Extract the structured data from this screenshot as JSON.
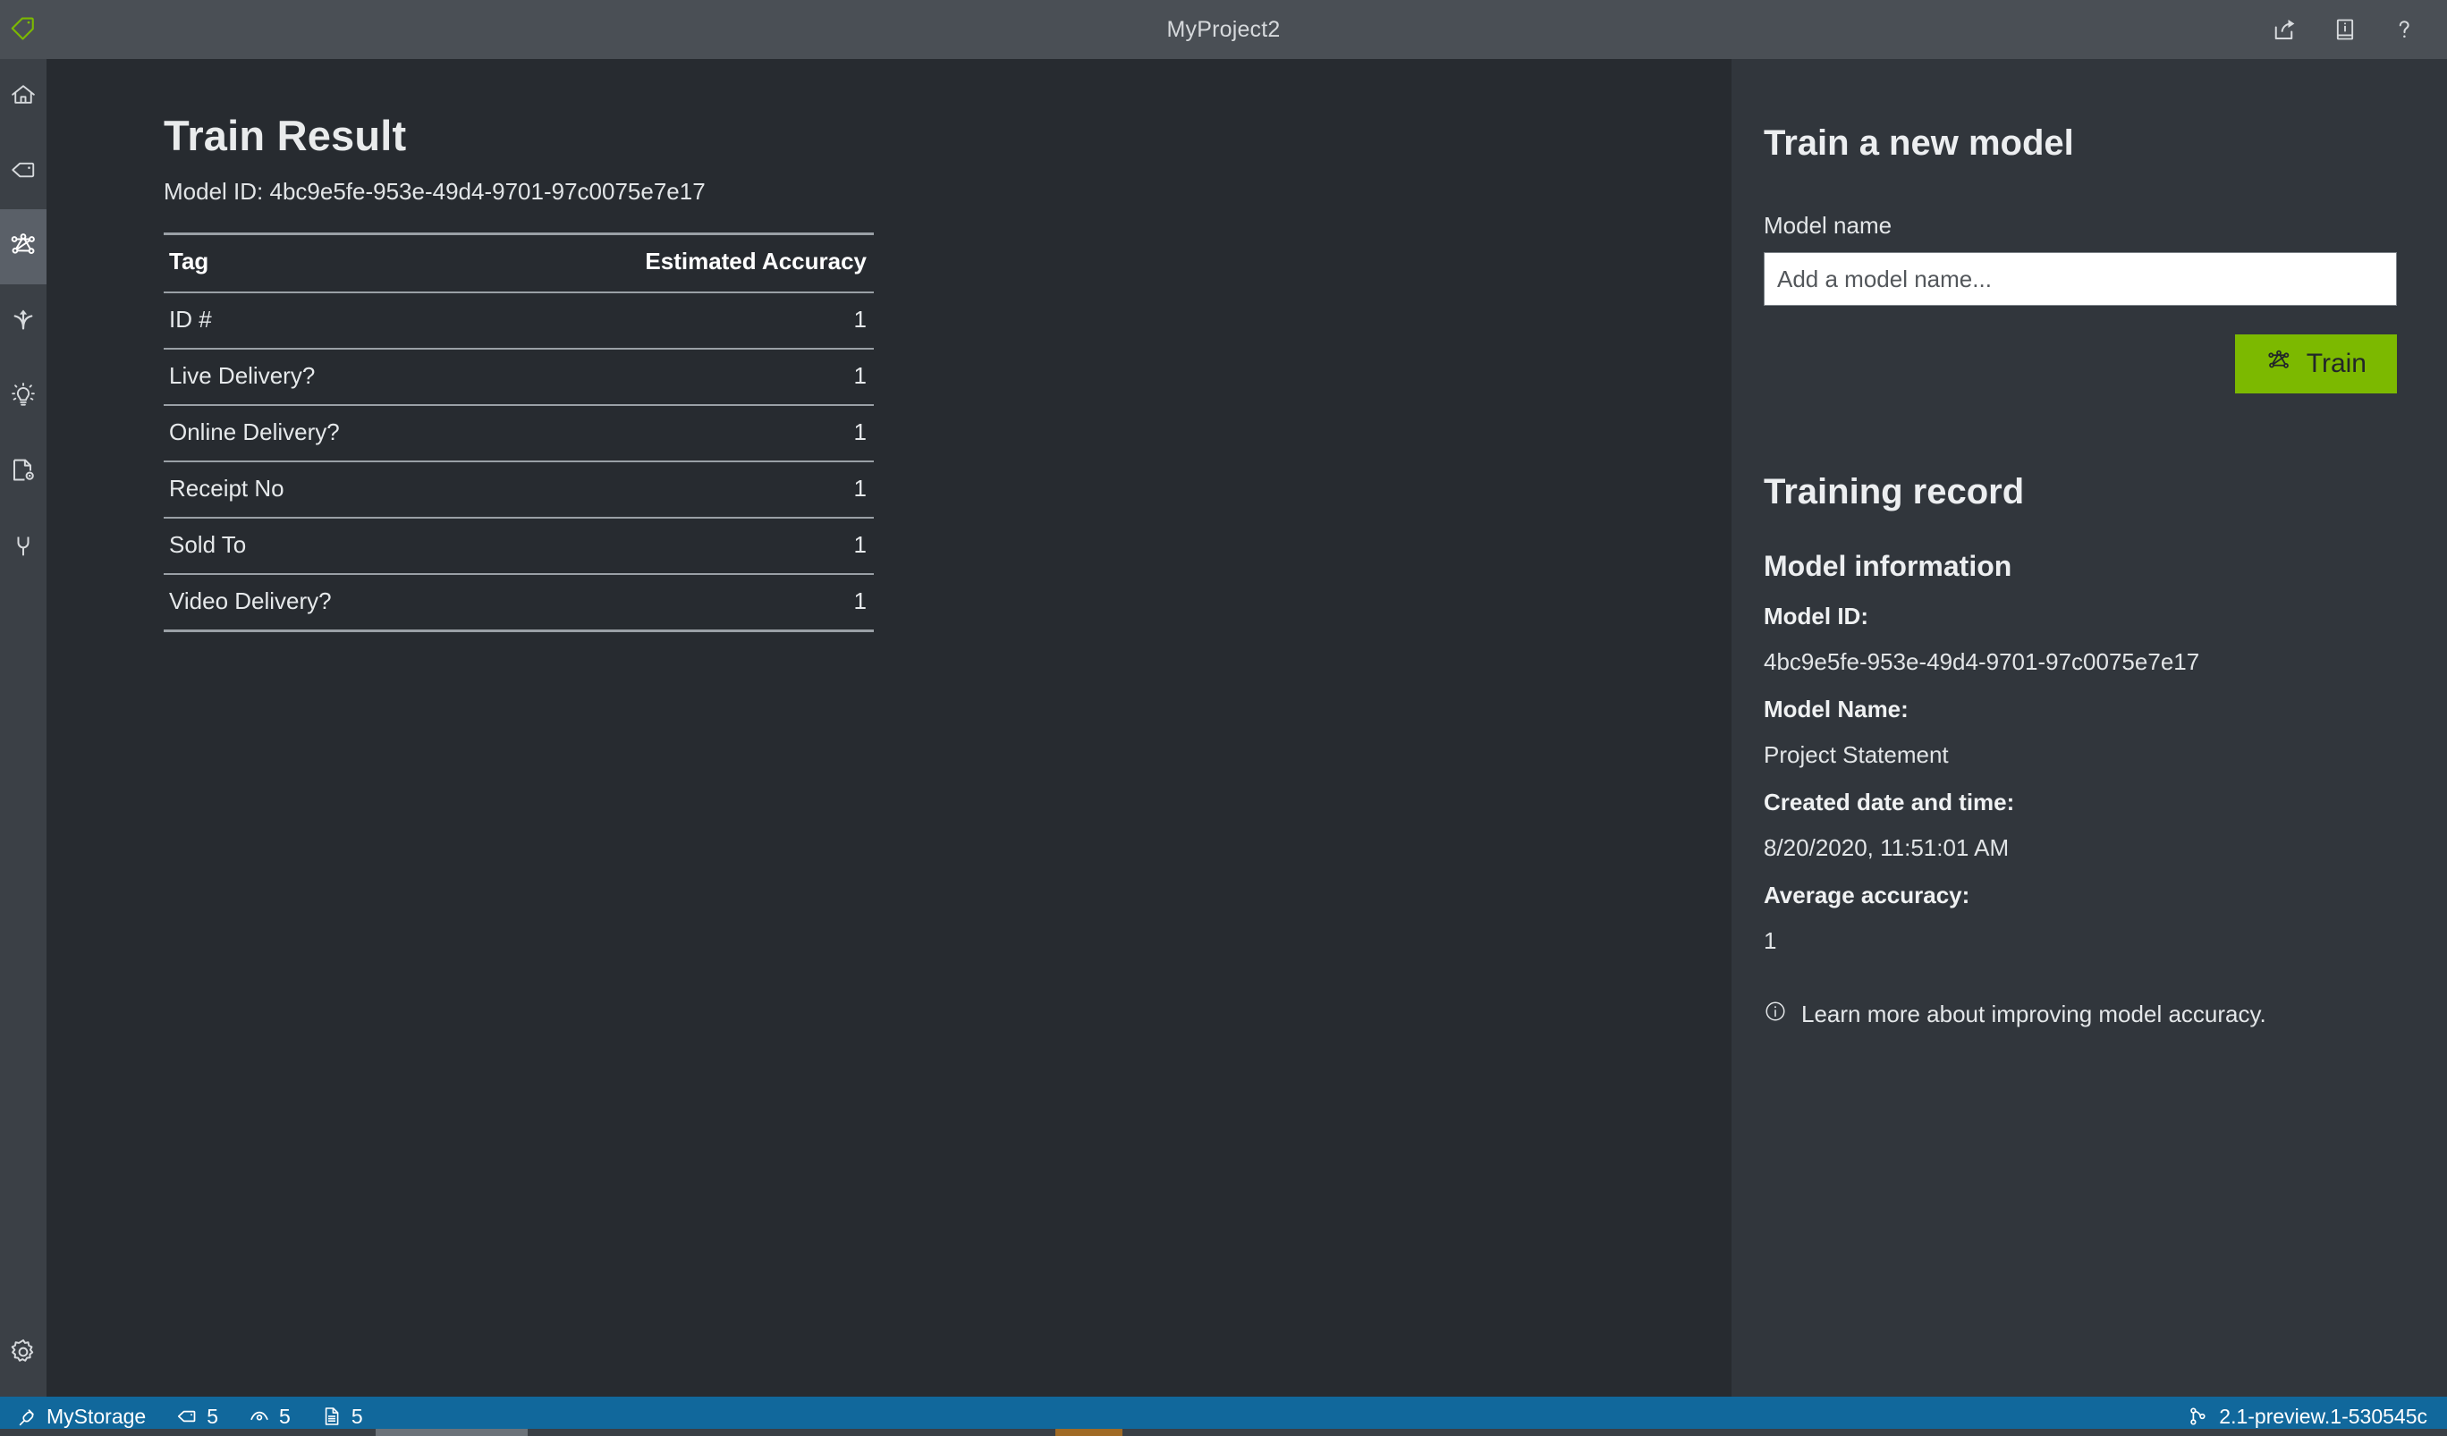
{
  "titlebar": {
    "title": "MyProject2",
    "logo_icon": "tag-logo-icon",
    "actions": [
      {
        "name": "share-icon",
        "label": "Share"
      },
      {
        "name": "documentation-icon",
        "label": "Documentation"
      },
      {
        "name": "help-icon",
        "label": "Help"
      }
    ]
  },
  "sidebar": {
    "items": [
      {
        "name": "home",
        "icon": "home-icon",
        "label": "Home",
        "active": false
      },
      {
        "name": "tags",
        "icon": "tag-icon",
        "label": "Tag Editor",
        "active": false
      },
      {
        "name": "train",
        "icon": "train-network-icon",
        "label": "Train",
        "active": true
      },
      {
        "name": "compose",
        "icon": "model-compose-icon",
        "label": "Model Compose",
        "active": false
      },
      {
        "name": "predict",
        "icon": "lightbulb-icon",
        "label": "Analyze",
        "active": false
      },
      {
        "name": "project-settings",
        "icon": "document-settings-icon",
        "label": "Project Settings",
        "active": false
      },
      {
        "name": "connections",
        "icon": "plug-icon",
        "label": "Connections",
        "active": false
      }
    ],
    "settings": {
      "name": "app-settings",
      "icon": "gear-icon",
      "label": "Application Settings"
    }
  },
  "main": {
    "page_title": "Train Result",
    "model_id_line": "Model ID: 4bc9e5fe-953e-49d4-9701-97c0075e7e17",
    "table": {
      "columns": [
        "Tag",
        "Estimated Accuracy"
      ],
      "rows": [
        {
          "tag": "ID #",
          "accuracy": "1"
        },
        {
          "tag": "Live Delivery?",
          "accuracy": "1"
        },
        {
          "tag": "Online Delivery?",
          "accuracy": "1"
        },
        {
          "tag": "Receipt No",
          "accuracy": "1"
        },
        {
          "tag": "Sold To",
          "accuracy": "1"
        },
        {
          "tag": "Video Delivery?",
          "accuracy": "1"
        }
      ]
    }
  },
  "right_panel": {
    "train_heading": "Train a new model",
    "model_name_label": "Model name",
    "model_name_value": "",
    "model_name_placeholder": "Add a model name...",
    "train_button_label": "Train",
    "train_button_icon": "train-network-icon",
    "training_record_heading": "Training record",
    "model_information_heading": "Model information",
    "fields": [
      {
        "key": "Model ID:",
        "value": "4bc9e5fe-953e-49d4-9701-97c0075e7e17"
      },
      {
        "key": "Model Name:",
        "value": "Project Statement"
      },
      {
        "key": "Created date and time:",
        "value": "8/20/2020, 11:51:01 AM"
      },
      {
        "key": "Average accuracy:",
        "value": "1"
      }
    ],
    "learn_more": "Learn more about improving model accuracy.",
    "learn_more_icon": "info-circle-icon"
  },
  "statusbar": {
    "storage_icon": "plug-icon",
    "storage_label": "MyStorage",
    "tag_icon": "tag-icon",
    "tag_count": "5",
    "eye_icon": "eye-icon",
    "eye_count": "5",
    "doc_icon": "document-icon",
    "doc_count": "5",
    "branch_icon": "branch-icon",
    "version": "2.1-preview.1-530545c"
  },
  "colors": {
    "titlebar_bg": "#4a4f55",
    "sidebar_bg": "#3b4046",
    "sidebar_active_bg": "#5a6068",
    "main_bg": "#272b30",
    "right_panel_bg": "#31363c",
    "accent_green": "#7cb900",
    "statusbar_bg": "#11689c",
    "logo_green": "#7cb900"
  }
}
